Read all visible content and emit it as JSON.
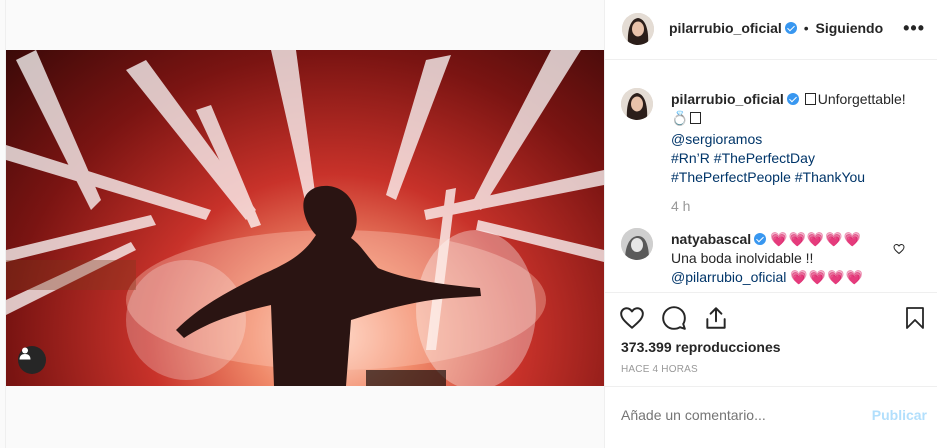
{
  "header": {
    "username": "pilarrubio_oficial",
    "separator": "•",
    "follow_label": "Siguiendo",
    "more_label": "•••"
  },
  "media": {
    "type": "video",
    "user_tag_icon": "user-icon"
  },
  "caption": {
    "username": "pilarrubio_oficial",
    "text_1": "Unforgettable!",
    "ring_emoji": "💍",
    "mention": "@sergioramos",
    "tags_line_1": "#Rn’R #ThePerfectDay",
    "tags_line_2": "#ThePerfectPeople #ThankYou",
    "time": "4 h"
  },
  "comment": {
    "username": "natyabascal",
    "hearts": "💗💗💗💗💗",
    "text": "Una boda inolvidable !!",
    "mention": "@pilarrubio_oficial",
    "hearts_2": "💗💗💗💗"
  },
  "actions": {
    "like_icon": "heart-icon",
    "comment_icon": "comment-icon",
    "share_icon": "share-icon",
    "save_icon": "bookmark-icon"
  },
  "stats": {
    "views": "373.399 reproducciones",
    "posted_ago": "HACE 4 HORAS"
  },
  "add_comment": {
    "placeholder": "Añade un comentario...",
    "publish_label": "Publicar"
  },
  "colors": {
    "verified": "#3897f0",
    "link": "#003569",
    "publish_disabled": "#b2dffc"
  }
}
